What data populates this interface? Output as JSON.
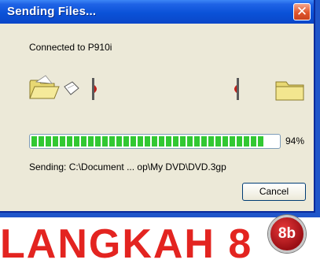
{
  "dialog": {
    "title": "Sending Files...",
    "close_label": "✕",
    "status": "Connected to P910i",
    "progress_fraction": 0.94,
    "progress_percent": "94%",
    "sending_line": "Sending: C:\\Document ... op\\My DVD\\DVD.3gp",
    "cancel_label": "Cancel"
  },
  "page": {
    "headline": "LANGKAH 8",
    "badge": "8b"
  },
  "colors": {
    "titlebar": "#0a52d8",
    "progress": "#32c832",
    "headline": "#e32420",
    "badge": "#c41a1f"
  },
  "icons": [
    "folder-open-icon",
    "flying-document-icon",
    "device-connector-icon",
    "folder-icon"
  ]
}
